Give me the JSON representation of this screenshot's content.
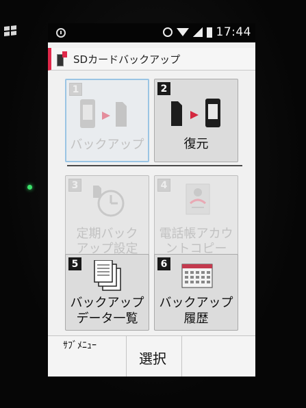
{
  "status_bar": {
    "time": "17:44",
    "icons": [
      "info-icon",
      "alarm-icon",
      "wifi-icon",
      "signal-icon",
      "battery-icon"
    ]
  },
  "title_bar": {
    "title": "SDカードバックアップ",
    "accent_color": "#e0284a"
  },
  "menu": {
    "items": [
      {
        "number": "1",
        "label_line1": "バックアップ",
        "label_line2": "",
        "enabled": false,
        "icon": "phone-to-sd-icon"
      },
      {
        "number": "2",
        "label_line1": "復元",
        "label_line2": "",
        "enabled": true,
        "icon": "sd-to-phone-icon"
      },
      {
        "number": "3",
        "label_line1": "定期バック",
        "label_line2": "アップ設定",
        "enabled": false,
        "icon": "scheduled-clock-icon"
      },
      {
        "number": "4",
        "label_line1": "電話帳アカウ",
        "label_line2": "ントコピー",
        "enabled": false,
        "icon": "contacts-copy-icon"
      },
      {
        "number": "5",
        "label_line1": "バックアップ",
        "label_line2": "データ一覧",
        "enabled": true,
        "icon": "document-list-icon"
      },
      {
        "number": "6",
        "label_line1": "バックアップ",
        "label_line2": "履歴",
        "enabled": true,
        "icon": "history-calendar-icon"
      }
    ]
  },
  "softkeys": {
    "left": "ｻﾌﾞﾒﾆｭｰ",
    "center": "選択",
    "right": ""
  }
}
